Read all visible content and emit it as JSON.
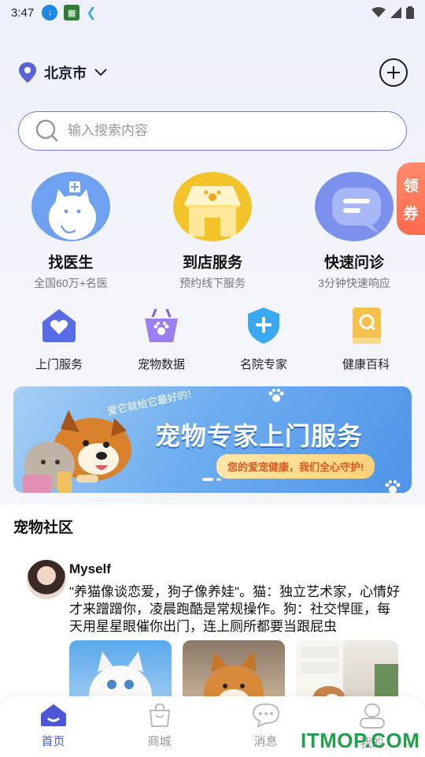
{
  "status_bar": {
    "time": "3:47"
  },
  "location": {
    "city": "北京市"
  },
  "search": {
    "placeholder": "输入搜索内容"
  },
  "side_tab": {
    "line1": "领",
    "line2": "券"
  },
  "big_services": [
    {
      "title": "找医生",
      "subtitle": "全国60万+名医",
      "icon": "cat-doctor-icon"
    },
    {
      "title": "到店服务",
      "subtitle": "预约线下服务",
      "icon": "pet-store-icon"
    },
    {
      "title": "快速问诊",
      "subtitle": "3分钟快速响应",
      "icon": "chat-bubble-icon"
    }
  ],
  "small_services": [
    {
      "label": "上门服务",
      "icon": "home-heart-icon"
    },
    {
      "label": "宠物数据",
      "icon": "paw-basket-icon"
    },
    {
      "label": "名院专家",
      "icon": "shield-plus-icon"
    },
    {
      "label": "健康百科",
      "icon": "book-search-icon"
    }
  ],
  "banner": {
    "script_text": "爱它就给它最好的!",
    "title": "宠物专家上门服务",
    "pill": "您的爱宠健康，我们全心守护!"
  },
  "community": {
    "heading": "宠物社区",
    "post": {
      "username": "Myself",
      "text": "\"养猫像谈恋爱，狗子像养娃\"。猫：独立艺术家，心情好才来蹭蹭你，凌晨跑酷是常规操作。狗：社交悍匪，每天用星星眼催你出门，连上厕所都要当跟屁虫"
    }
  },
  "tabbar": [
    {
      "label": "首页",
      "icon": "home-icon",
      "active": true
    },
    {
      "label": "商城",
      "icon": "shopping-bag-icon",
      "active": false
    },
    {
      "label": "消息",
      "icon": "message-icon",
      "active": false
    },
    {
      "label": "我的",
      "icon": "profile-icon",
      "active": false
    }
  ],
  "watermark": "ITMOP.COM",
  "colors": {
    "accent": "#4b57d6",
    "coupon": "#ff6a4d",
    "banner_blue": "#4f94e8"
  }
}
